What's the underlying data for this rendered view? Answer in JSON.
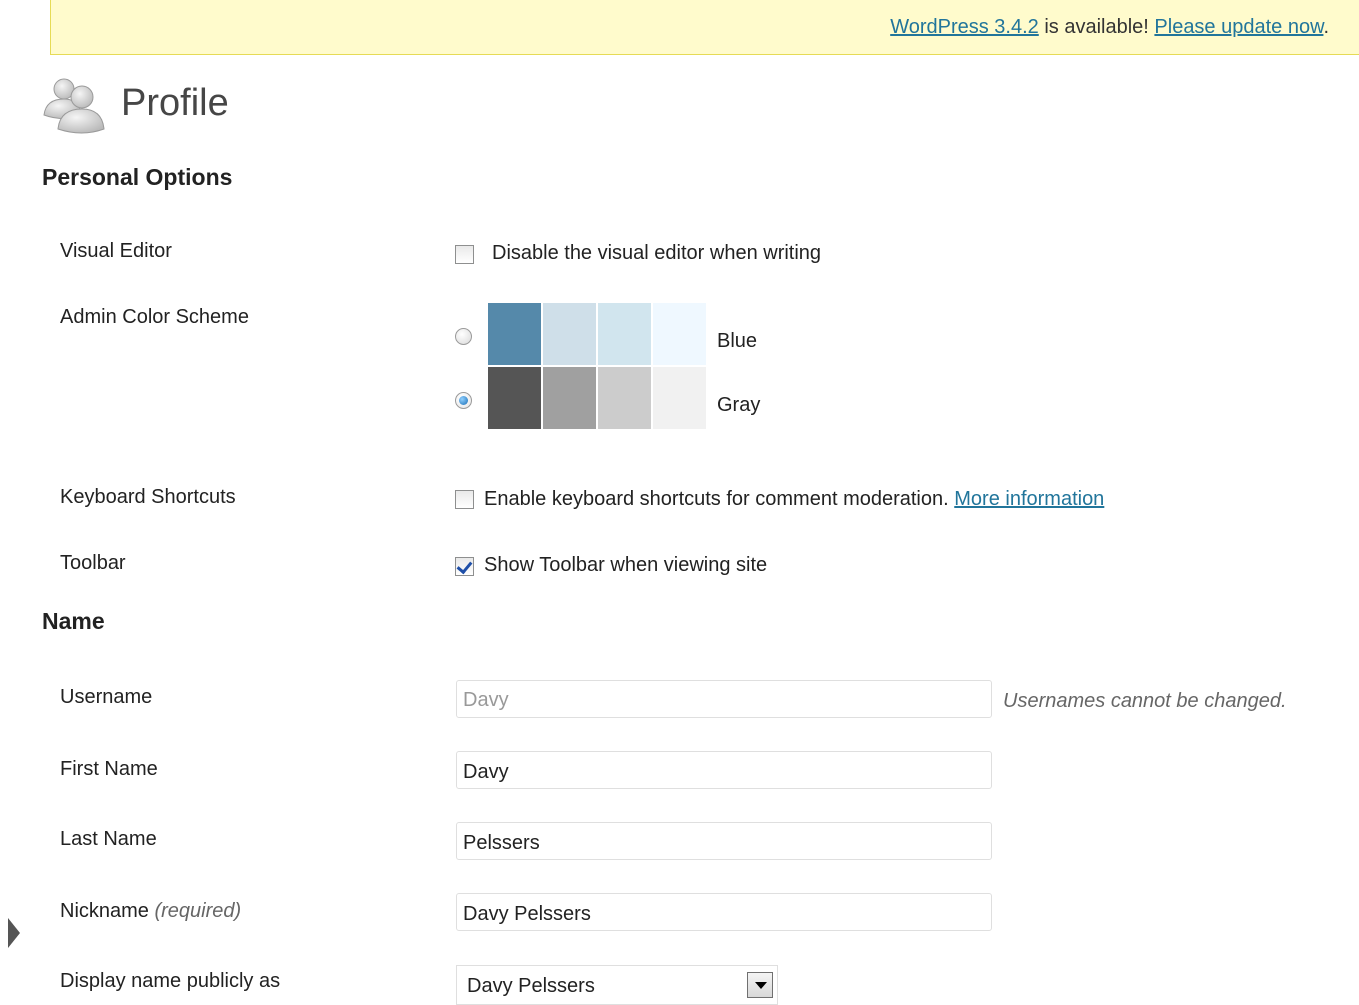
{
  "notice": {
    "version_link": "WordPress 3.4.2",
    "middle": " is available! ",
    "update_link": "Please update now",
    "end": "."
  },
  "header": {
    "title": "Profile",
    "icon": "users-icon"
  },
  "personal_options": {
    "title": "Personal Options",
    "visual_editor": {
      "label": "Visual Editor",
      "checkbox_label": "Disable the visual editor when writing",
      "checked": false
    },
    "color_scheme": {
      "label": "Admin Color Scheme",
      "options": [
        {
          "name": "Blue",
          "selected": false,
          "colors": [
            "#5589aa",
            "#cfdfe9",
            "#d1e5ee",
            "#eff8ff"
          ]
        },
        {
          "name": "Gray",
          "selected": true,
          "colors": [
            "#555555",
            "#a0a0a0",
            "#cccccc",
            "#f1f1f1"
          ]
        }
      ]
    },
    "keyboard_shortcuts": {
      "label": "Keyboard Shortcuts",
      "checkbox_label": "Enable keyboard shortcuts for comment moderation.",
      "link": "More information",
      "checked": false
    },
    "toolbar": {
      "label": "Toolbar",
      "checkbox_label": "Show Toolbar when viewing site",
      "checked": true
    }
  },
  "name_section": {
    "title": "Name",
    "username": {
      "label": "Username",
      "value": "Davy",
      "hint": "Usernames cannot be changed."
    },
    "first_name": {
      "label": "First Name",
      "value": "Davy"
    },
    "last_name": {
      "label": "Last Name",
      "value": "Pelssers"
    },
    "nickname": {
      "label": "Nickname",
      "required": "(required)",
      "value": "Davy Pelssers"
    },
    "display_name": {
      "label": "Display name publicly as",
      "value": "Davy Pelssers"
    }
  }
}
